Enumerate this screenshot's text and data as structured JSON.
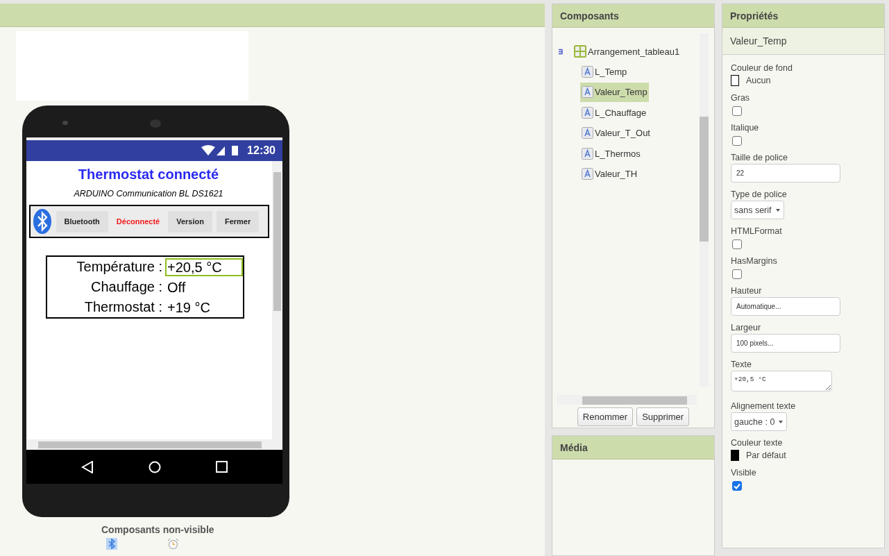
{
  "viewer": {
    "phone": {
      "status_time": "12:30",
      "title": "Thermostat connecté",
      "subtitle": "ARDUINO Communication BL DS1621",
      "toolbar": [
        {
          "kind": "button",
          "label": "Bluetooth"
        },
        {
          "kind": "status",
          "label": "Déconnecté"
        },
        {
          "kind": "button",
          "label": "Version"
        },
        {
          "kind": "button",
          "label": "Fermer"
        }
      ],
      "table": [
        {
          "label": "Température :",
          "value": "+20,5 °C",
          "selected": true
        },
        {
          "label": "Chauffage :",
          "value": "Off",
          "selected": false
        },
        {
          "label": "Thermostat :",
          "value": "+19 °C",
          "selected": false
        }
      ]
    },
    "non_visible": {
      "title": "Composants non-visible"
    }
  },
  "components": {
    "title": "Composants",
    "tree": [
      {
        "kind": "arrangement",
        "label": "Arrangement_tableau1",
        "expanded": true,
        "selected": false,
        "children": [
          {
            "kind": "label",
            "label": "L_Temp",
            "selected": false
          },
          {
            "kind": "label",
            "label": "Valeur_Temp",
            "selected": true
          },
          {
            "kind": "label",
            "label": "L_Chauffage",
            "selected": false
          },
          {
            "kind": "label",
            "label": "Valeur_T_Out",
            "selected": false
          },
          {
            "kind": "label",
            "label": "L_Thermos",
            "selected": false
          },
          {
            "kind": "label",
            "label": "Valeur_TH",
            "selected": false
          }
        ]
      }
    ],
    "buttons": [
      "Renommer",
      "Supprimer"
    ]
  },
  "media": {
    "title": "Média"
  },
  "properties": {
    "title": "Propriétés",
    "component": "Valeur_Temp",
    "items": [
      {
        "kind": "color",
        "label": "Couleur de fond",
        "value": "Aucun",
        "color": "#ffffff"
      },
      {
        "kind": "checkbox",
        "label": "Gras",
        "checked": false
      },
      {
        "kind": "checkbox",
        "label": "Italique",
        "checked": false
      },
      {
        "kind": "textbox",
        "label": "Taille de police",
        "value": "22"
      },
      {
        "kind": "dropdown",
        "label": "Type de police",
        "value": "sans serif"
      },
      {
        "kind": "checkbox",
        "label": "HTMLFormat",
        "checked": false
      },
      {
        "kind": "checkbox",
        "label": "HasMargins",
        "checked": false
      },
      {
        "kind": "textbox",
        "label": "Hauteur",
        "value": "Automatique..."
      },
      {
        "kind": "textbox",
        "label": "Largeur",
        "value": "100 pixels..."
      },
      {
        "kind": "textarea",
        "label": "Texte",
        "value": "+20,5 °C"
      },
      {
        "kind": "dropdown",
        "label": "Alignement texte",
        "value": "gauche : 0"
      },
      {
        "kind": "color",
        "label": "Couleur texte",
        "value": "Par défaut",
        "color": "#000000"
      },
      {
        "kind": "checkbox",
        "label": "Visible",
        "checked": true
      }
    ]
  }
}
